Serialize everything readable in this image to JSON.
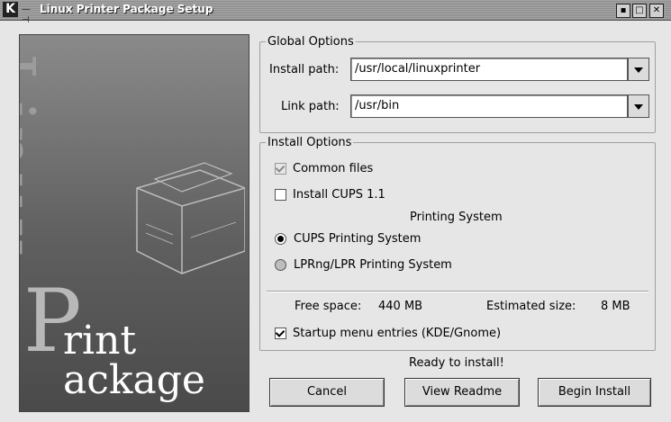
{
  "window": {
    "title": "Linux Printer Package Setup",
    "app_icon": "kde-k-icon",
    "pin_icon": "pin-icon"
  },
  "banner": {
    "vertical_text": "Linux",
    "initial": "P",
    "word1": "rint",
    "word2": "ackage"
  },
  "global_options": {
    "legend": "Global Options",
    "install_path_label": "Install path:",
    "install_path_value": "/usr/local/linuxprinter",
    "link_path_label": "Link path:",
    "link_path_value": "/usr/bin"
  },
  "install_options": {
    "legend": "Install Options",
    "common_files": {
      "label": "Common files",
      "checked": true,
      "enabled": false
    },
    "install_cups": {
      "label": "Install CUPS 1.1",
      "checked": false
    },
    "printing_system_heading": "Printing System",
    "cups": {
      "label": "CUPS Printing System",
      "selected": true
    },
    "lprng": {
      "label": "LPRng/LPR Printing System",
      "selected": false
    },
    "free_space_label": "Free space:",
    "free_space_value": "440 MB",
    "estimated_size_label": "Estimated size:",
    "estimated_size_value": "8 MB",
    "startup_menu": {
      "label": "Startup menu entries (KDE/Gnome)",
      "checked": true
    }
  },
  "status_text": "Ready to install!",
  "buttons": {
    "cancel": "Cancel",
    "view_readme": "View Readme",
    "begin_install": "Begin Install"
  }
}
